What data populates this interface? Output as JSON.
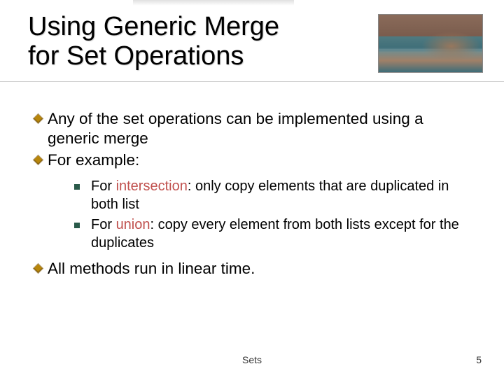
{
  "title_line1": "Using Generic Merge",
  "title_line2": "for Set Operations",
  "bullets": {
    "b1": "Any of the set operations can be implemented using a generic merge",
    "b2": "For example:",
    "b3": "All methods run in linear time."
  },
  "sub": {
    "s1_prefix": "For ",
    "s1_accent": "intersection",
    "s1_rest": ": only copy elements that are duplicated in both list",
    "s2_prefix": "For ",
    "s2_accent": "union",
    "s2_rest": ": copy every element from both lists except for the duplicates"
  },
  "footer_label": "Sets",
  "page_number": "5",
  "colors": {
    "accent_text": "#c0504d",
    "diamond_bullet": "#b8860b",
    "square_bullet": "#2a5a4a"
  }
}
